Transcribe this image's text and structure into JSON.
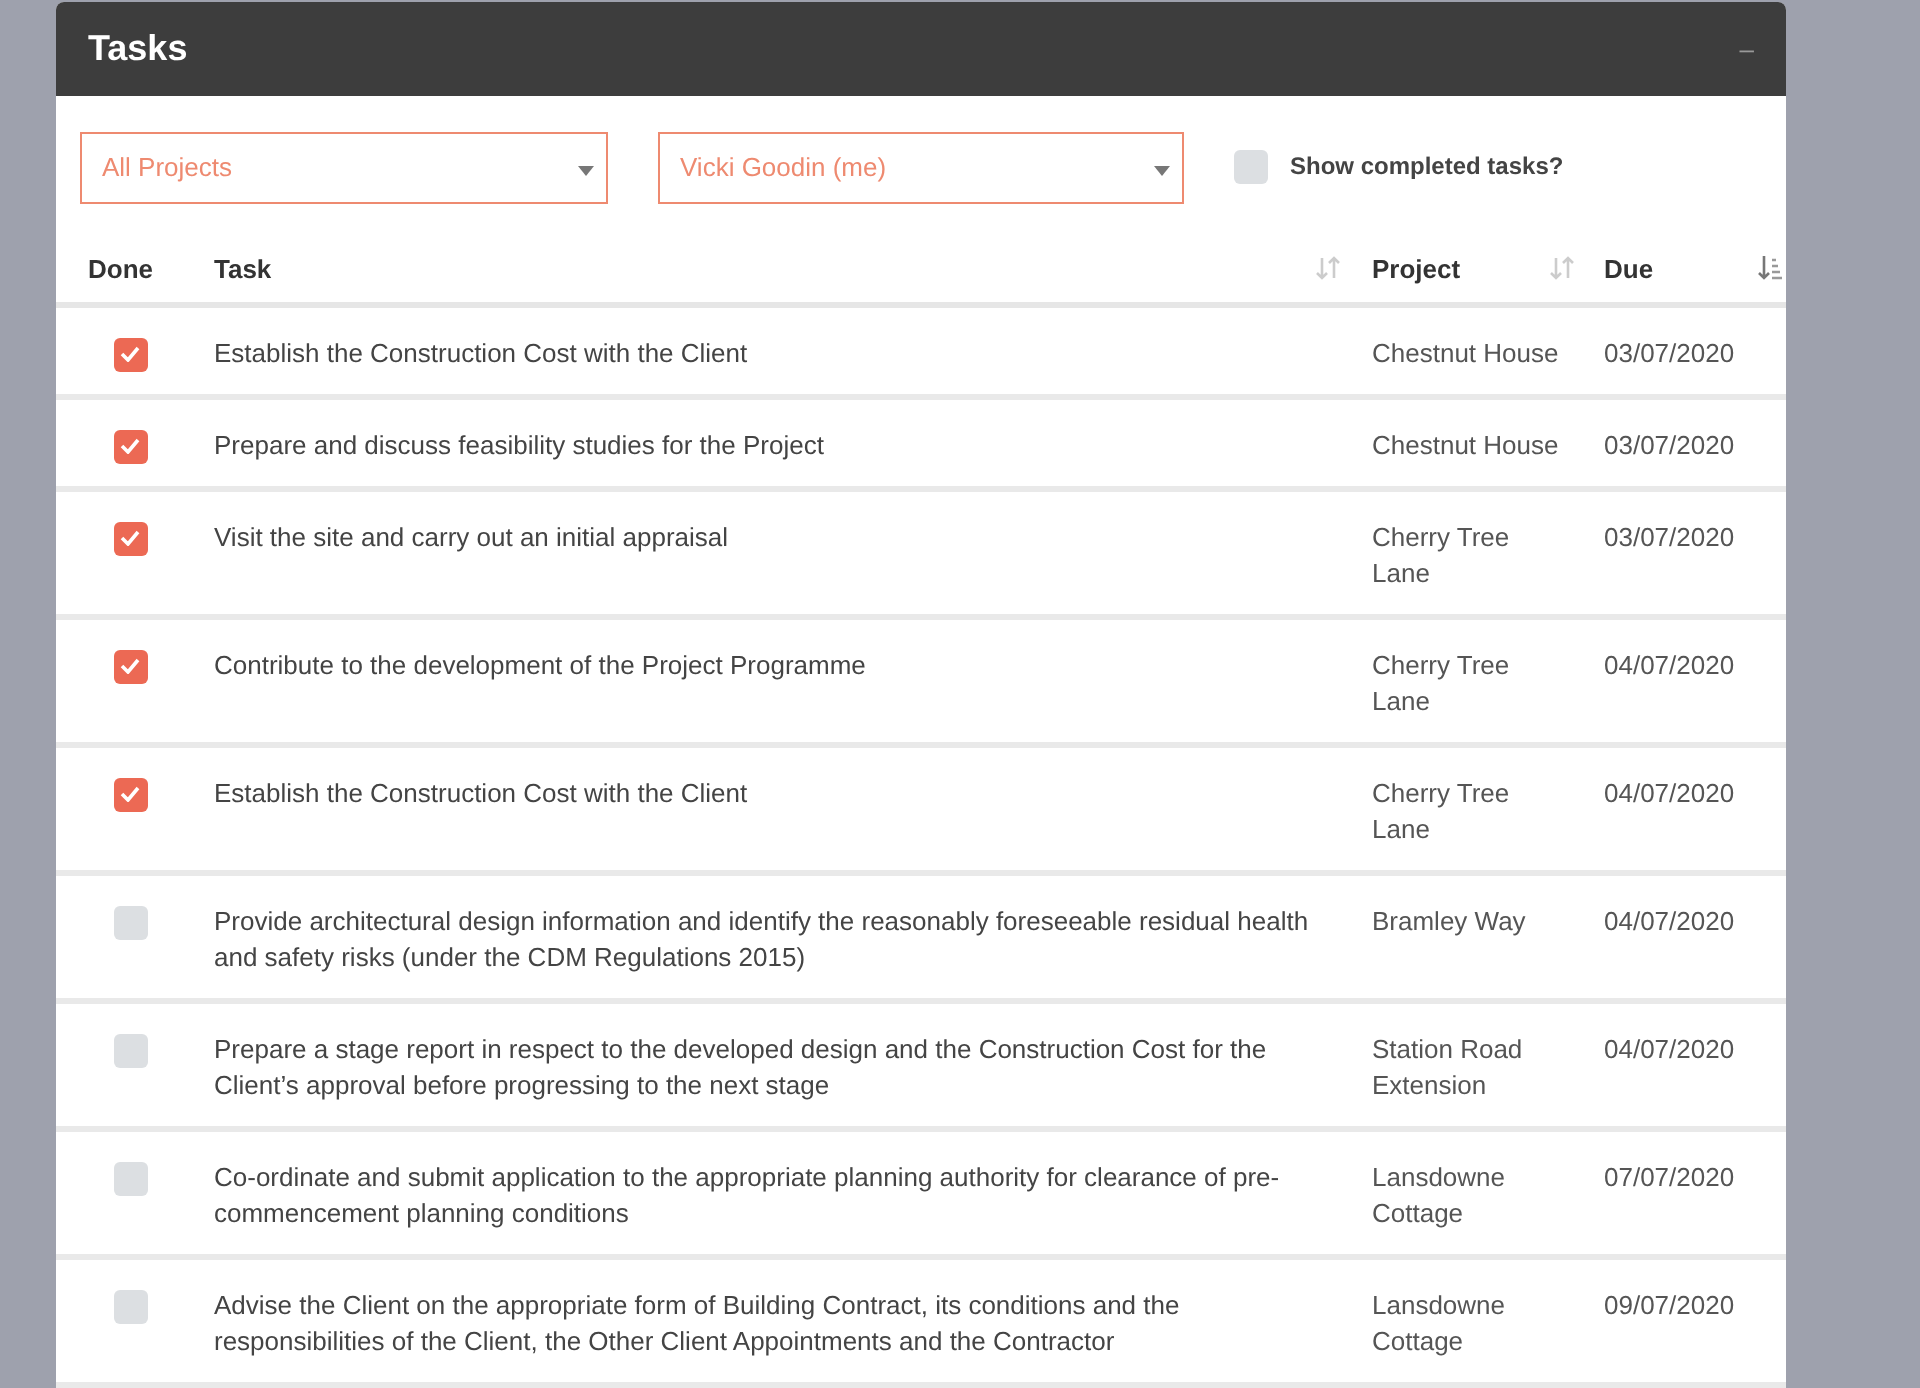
{
  "panel": {
    "title": "Tasks",
    "minimize_icon": "–"
  },
  "filters": {
    "project": "All Projects",
    "assignee": "Vicki Goodin (me)",
    "show_completed": {
      "label": "Show completed tasks?",
      "checked": false
    }
  },
  "table": {
    "columns": [
      {
        "label": "Done"
      },
      {
        "label": "Task",
        "sorted": false
      },
      {
        "label": "Project",
        "sorted": false
      },
      {
        "label": "Due",
        "sorted": true
      }
    ],
    "rows": [
      {
        "done": true,
        "task": "Establish the Construction Cost with the Client",
        "project": "Chestnut House",
        "due": "03/07/2020"
      },
      {
        "done": true,
        "task": "Prepare and discuss feasibility studies for the Project",
        "project": "Chestnut House",
        "due": "03/07/2020"
      },
      {
        "done": true,
        "task": "Visit the site and carry out an initial appraisal",
        "project": "Cherry Tree Lane",
        "due": "03/07/2020"
      },
      {
        "done": true,
        "task": "Contribute to the development of the Project Programme",
        "project": "Cherry Tree Lane",
        "due": "04/07/2020"
      },
      {
        "done": true,
        "task": "Establish the Construction Cost with the Client",
        "project": "Cherry Tree Lane",
        "due": "04/07/2020"
      },
      {
        "done": false,
        "task": "Provide architectural design information and identify the reasonably foreseeable residual health and safety risks (under the CDM Regulations 2015)",
        "project": "Bramley Way",
        "due": "04/07/2020"
      },
      {
        "done": false,
        "task": "Prepare a stage report in respect to the developed design and the Construction Cost for the Client’s approval before progressing to the next stage",
        "project": "Station Road Extension",
        "due": "04/07/2020"
      },
      {
        "done": false,
        "task": "Co-ordinate and submit application to the appropriate planning authority for clearance of pre-commencement planning conditions",
        "project": "Lansdowne Cottage",
        "due": "07/07/2020"
      },
      {
        "done": false,
        "task": "Advise the Client on the appropriate form of Building Contract, its conditions and the responsibilities of the Client, the Other Client Appointments and the Contractor",
        "project": "Lansdowne Cottage",
        "due": "09/07/2020"
      }
    ]
  }
}
